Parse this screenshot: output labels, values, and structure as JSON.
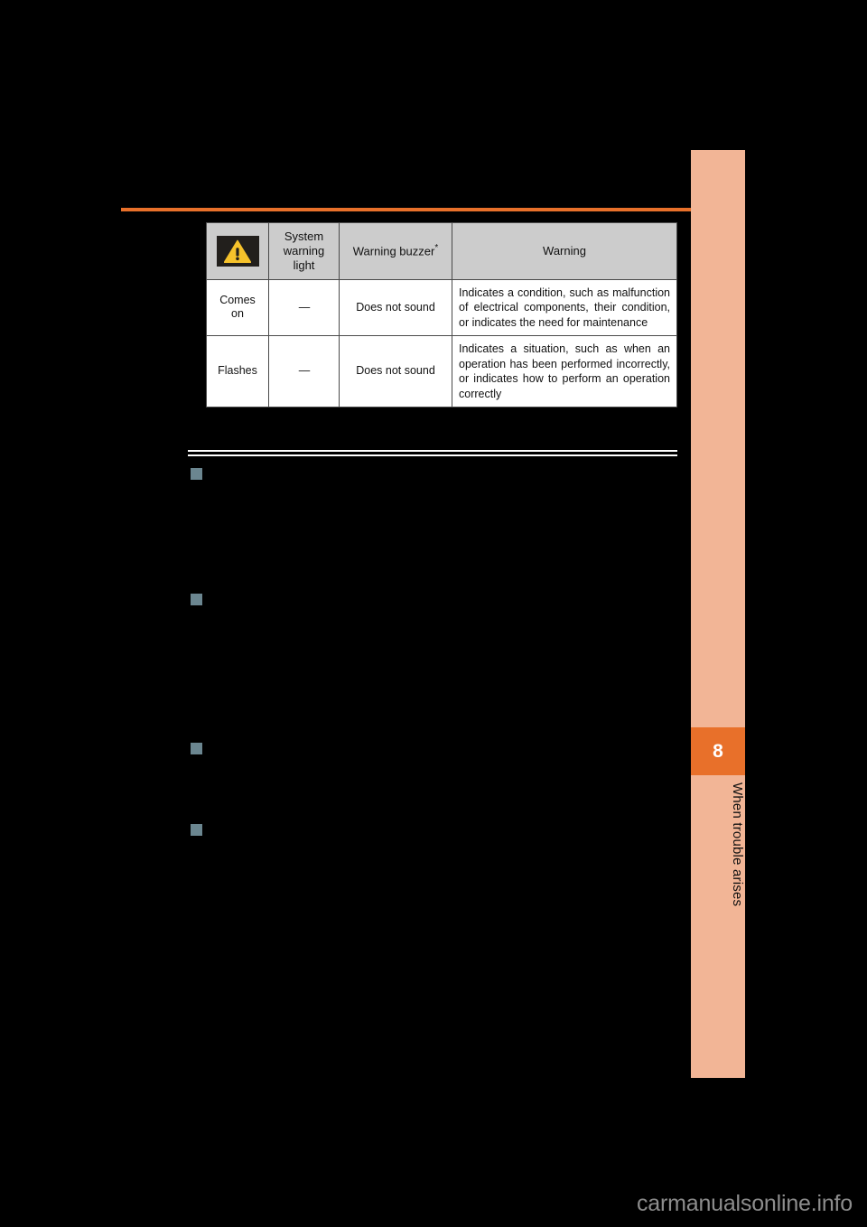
{
  "page": {
    "background_color": "#000000",
    "accent_color": "#e8702a",
    "sidebar_color": "#f2b596",
    "bullet_color": "#6b8690"
  },
  "sidebar": {
    "chapter_number": "8",
    "chapter_title": "When trouble arises"
  },
  "table": {
    "headers": {
      "icon": "warning-triangle-icon",
      "system_warning_light": "System\nwarning\nlight",
      "system_warning_light_lines": [
        "System",
        "warning",
        "light"
      ],
      "warning_buzzer": "Warning buzzer",
      "warning_buzzer_footnote": "*",
      "warning": "Warning"
    },
    "rows": [
      {
        "light": "Comes on",
        "light_lines": [
          "Comes",
          "on"
        ],
        "buzzer_dash": "—",
        "buzzer": "Does not sound",
        "warning": "Indicates a condition, such as malfunction of electrical components, their condition, or indicates the need for maintenance"
      },
      {
        "light": "Flashes",
        "light_lines": [
          "Flashes"
        ],
        "buzzer_dash": "—",
        "buzzer": "Does not sound",
        "warning": "Indicates a situation, such as when an operation has been performed incorrectly, or indicates how to perform an operation correctly"
      }
    ]
  },
  "sections": [
    {
      "bullet": "■",
      "heading": "",
      "body": ""
    },
    {
      "bullet": "■",
      "heading": "",
      "body": ""
    },
    {
      "bullet": "■",
      "heading": "",
      "body": ""
    },
    {
      "bullet": "■",
      "heading": "",
      "body": ""
    }
  ],
  "watermark": {
    "text": "carmanualsonline.info"
  }
}
